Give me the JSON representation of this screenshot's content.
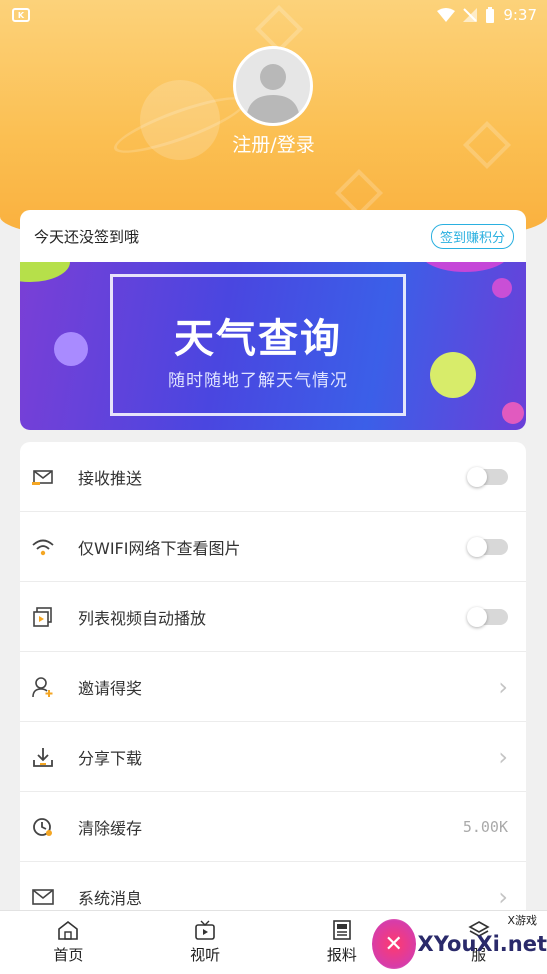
{
  "statusbar": {
    "time": "9:37",
    "app_icon": "K"
  },
  "header": {
    "login_label": "注册/登录"
  },
  "signin": {
    "text": "今天还没签到哦",
    "button": "签到赚积分"
  },
  "banner": {
    "title": "天气查询",
    "subtitle": "随时随地了解天气情况"
  },
  "menu": {
    "items": [
      {
        "label": "接收推送",
        "icon": "envelope-icon",
        "control": "toggle"
      },
      {
        "label": "仅WIFI网络下查看图片",
        "icon": "wifi-icon",
        "control": "toggle"
      },
      {
        "label": "列表视频自动播放",
        "icon": "video-play-icon",
        "control": "toggle"
      },
      {
        "label": "邀请得奖",
        "icon": "add-user-icon",
        "control": "chevron"
      },
      {
        "label": "分享下载",
        "icon": "download-icon",
        "control": "chevron"
      },
      {
        "label": "清除缓存",
        "icon": "clock-clear-icon",
        "control": "value",
        "value": "5.00K"
      },
      {
        "label": "系统消息",
        "icon": "mail-icon",
        "control": "chevron"
      }
    ]
  },
  "tabs": [
    {
      "label": "首页",
      "icon": "home-icon"
    },
    {
      "label": "视听",
      "icon": "tv-icon"
    },
    {
      "label": "报料",
      "icon": "newspaper-icon"
    },
    {
      "label": "服",
      "icon": "layers-icon"
    }
  ],
  "watermark": {
    "text": "XYouXi.net",
    "small": "X游戏"
  },
  "colors": {
    "header": "#fbbf52",
    "accent_blue": "#2ab0e0",
    "banner": "#4a46e0"
  }
}
